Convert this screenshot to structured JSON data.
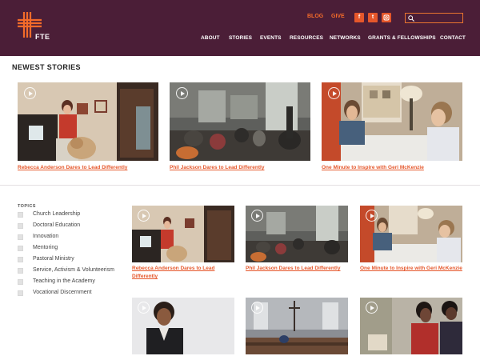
{
  "header": {
    "logo_text": "FTE",
    "top_links": {
      "blog": "BLOG",
      "give": "GIVE"
    },
    "social": [
      "f",
      "t",
      "in"
    ],
    "search": {
      "placeholder": ""
    },
    "nav": [
      "ABOUT",
      "STORIES",
      "EVENTS",
      "RESOURCES",
      "NETWORKS",
      "GRANTS & FELLOWSHIPS",
      "CONTACT"
    ]
  },
  "newest": {
    "title": "NEWEST STORIES",
    "items": [
      {
        "label": "Rebecca Anderson Dares to Lead Differently"
      },
      {
        "label": "Phil Jackson Dares to Lead Differently"
      },
      {
        "label": "One Minute to Inspire with Geri McKenzie"
      }
    ]
  },
  "topics": {
    "title": "TOPICS",
    "items": [
      "Church Leadership",
      "Doctoral Education",
      "Innovation",
      "Mentoring",
      "Pastoral Ministry",
      "Service, Activism & Volunteerism",
      "Teaching in the Academy",
      "Vocational Discernment"
    ]
  },
  "grid": {
    "items": [
      {
        "label": "Rebecca Anderson Dares to Lead Differently"
      },
      {
        "label": "Phil Jackson Dares to Lead Differently"
      },
      {
        "label": "One Minute to Inspire with Geri McKenzie"
      },
      {
        "label": ""
      },
      {
        "label": ""
      },
      {
        "label": ""
      }
    ]
  },
  "colors": {
    "header": "#4b1e37",
    "accent": "#e5572b"
  },
  "icons": [
    "fte-logo-icon",
    "facebook-icon",
    "twitter-icon",
    "instagram-icon",
    "search-icon",
    "play-icon"
  ]
}
